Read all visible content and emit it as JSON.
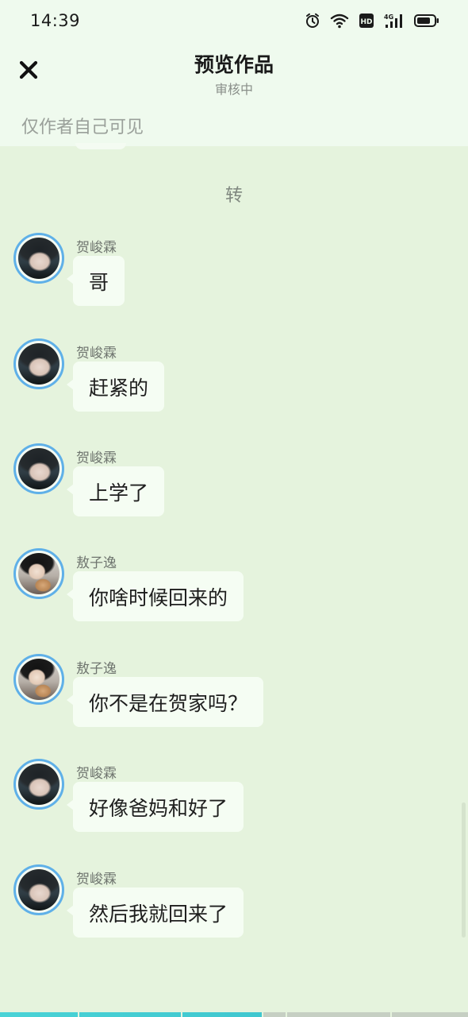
{
  "status_bar": {
    "time": "14:39",
    "icons": [
      "alarm-icon",
      "wifi-icon",
      "hd-icon",
      "4g-signal-icon",
      "battery-icon"
    ],
    "network_label": "4G",
    "hd_label": "HD"
  },
  "header": {
    "title": "预览作品",
    "subtitle": "审核中",
    "visibility_note": "仅作者自己可见",
    "close_icon": "close-icon"
  },
  "chat": {
    "divider_text": "转",
    "messages": [
      {
        "sender": "贺峻霖",
        "text": "哥",
        "avatar": "avatar-hejunlin"
      },
      {
        "sender": "贺峻霖",
        "text": "赶紧的",
        "avatar": "avatar-hejunlin"
      },
      {
        "sender": "贺峻霖",
        "text": "上学了",
        "avatar": "avatar-hejunlin"
      },
      {
        "sender": "敖子逸",
        "text": "你啥时候回来的",
        "avatar": "avatar-aoziyi"
      },
      {
        "sender": "敖子逸",
        "text": "你不是在贺家吗？",
        "avatar": "avatar-aoziyi"
      },
      {
        "sender": "贺峻霖",
        "text": "好像爸妈和好了",
        "avatar": "avatar-hejunlin"
      },
      {
        "sender": "贺峻霖",
        "text": "然后我就回来了",
        "avatar": "avatar-hejunlin"
      }
    ]
  },
  "progress": {
    "fraction": 0.56,
    "segments": 5
  },
  "colors": {
    "background": "#e5f3dd",
    "header_bg": "#effaee",
    "bubble": "#f5fdf3",
    "avatar_ring": "#5fb0e8",
    "progress": "#45cdd3"
  }
}
